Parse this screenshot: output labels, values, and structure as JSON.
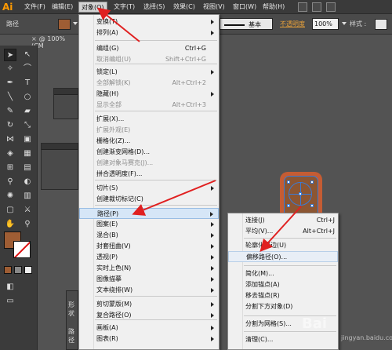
{
  "app": {
    "logo": "Ai",
    "menus": [
      "文件(F)",
      "编辑(E)",
      "对象(O)",
      "文字(T)",
      "选择(S)",
      "效果(C)",
      "视图(V)",
      "窗口(W)",
      "帮助(H)"
    ],
    "active_menu": "对象(O)"
  },
  "control_bar": {
    "selection_label": "路径",
    "stroke_style": "基本",
    "opacity_label": "不透明度",
    "opacity_value": "100%",
    "style_label": "样式 :",
    "fill_color": "#9e5d34"
  },
  "document": {
    "tab_label": "@ 100% (CM"
  },
  "tools": {
    "fill_color": "#9e5d34",
    "stroke_color": "#ffffff"
  },
  "object_menu": {
    "items": [
      {
        "label": "变换(T)",
        "shortcut": "",
        "submenu": true,
        "disabled": false
      },
      {
        "label": "排列(A)",
        "shortcut": "",
        "submenu": true,
        "disabled": false
      },
      {
        "label": "编组(G)",
        "shortcut": "Ctrl+G",
        "submenu": false,
        "disabled": false
      },
      {
        "label": "取消编组(U)",
        "shortcut": "Shift+Ctrl+G",
        "submenu": false,
        "disabled": true
      },
      {
        "label": "锁定(L)",
        "shortcut": "",
        "submenu": true,
        "disabled": false
      },
      {
        "label": "全部解锁(K)",
        "shortcut": "Alt+Ctrl+2",
        "submenu": false,
        "disabled": true
      },
      {
        "label": "隐藏(H)",
        "shortcut": "",
        "submenu": true,
        "disabled": false
      },
      {
        "label": "显示全部",
        "shortcut": "Alt+Ctrl+3",
        "submenu": false,
        "disabled": true
      },
      {
        "label": "扩展(X)...",
        "shortcut": "",
        "submenu": false,
        "disabled": false
      },
      {
        "label": "扩展外观(E)",
        "shortcut": "",
        "submenu": false,
        "disabled": true
      },
      {
        "label": "栅格化(Z)...",
        "shortcut": "",
        "submenu": false,
        "disabled": false
      },
      {
        "label": "创建渐变网格(D)...",
        "shortcut": "",
        "submenu": false,
        "disabled": false
      },
      {
        "label": "创建对象马赛克(J)...",
        "shortcut": "",
        "submenu": false,
        "disabled": true
      },
      {
        "label": "拼合透明度(F)...",
        "shortcut": "",
        "submenu": false,
        "disabled": false
      },
      {
        "label": "切片(S)",
        "shortcut": "",
        "submenu": true,
        "disabled": false
      },
      {
        "label": "创建裁切标记(C)",
        "shortcut": "",
        "submenu": false,
        "disabled": false
      },
      {
        "label": "路径(P)",
        "shortcut": "",
        "submenu": true,
        "disabled": false
      },
      {
        "label": "图案(E)",
        "shortcut": "",
        "submenu": true,
        "disabled": false
      },
      {
        "label": "混合(B)",
        "shortcut": "",
        "submenu": true,
        "disabled": false
      },
      {
        "label": "封套扭曲(V)",
        "shortcut": "",
        "submenu": true,
        "disabled": false
      },
      {
        "label": "透视(P)",
        "shortcut": "",
        "submenu": true,
        "disabled": false
      },
      {
        "label": "实时上色(N)",
        "shortcut": "",
        "submenu": true,
        "disabled": false
      },
      {
        "label": "图像描摹",
        "shortcut": "",
        "submenu": true,
        "disabled": false
      },
      {
        "label": "文本绕排(W)",
        "shortcut": "",
        "submenu": true,
        "disabled": false
      },
      {
        "label": "剪切蒙版(M)",
        "shortcut": "",
        "submenu": true,
        "disabled": false
      },
      {
        "label": "复合路径(O)",
        "shortcut": "",
        "submenu": true,
        "disabled": false
      },
      {
        "label": "画板(A)",
        "shortcut": "",
        "submenu": true,
        "disabled": false
      },
      {
        "label": "图表(R)",
        "shortcut": "",
        "submenu": true,
        "disabled": false
      }
    ]
  },
  "path_submenu": {
    "items": [
      {
        "label": "连接(J)",
        "shortcut": "Ctrl+J",
        "disabled": false
      },
      {
        "label": "平均(V)...",
        "shortcut": "Alt+Ctrl+J",
        "disabled": false
      },
      {
        "label": "轮廓化描边(U)",
        "shortcut": "",
        "disabled": false
      },
      {
        "label": "偏移路径(O)...",
        "shortcut": "",
        "disabled": false
      },
      {
        "label": "简化(M)...",
        "shortcut": "",
        "disabled": false
      },
      {
        "label": "添加锚点(A)",
        "shortcut": "",
        "disabled": false
      },
      {
        "label": "移去锚点(R)",
        "shortcut": "",
        "disabled": false
      },
      {
        "label": "分割下方对象(D)",
        "shortcut": "",
        "disabled": false
      },
      {
        "label": "分割为网格(S)...",
        "shortcut": "",
        "disabled": false
      },
      {
        "label": "清理(C)...",
        "shortcut": "",
        "disabled": false
      }
    ]
  },
  "canvas_art": {
    "outer_color": "#c55c33",
    "inner_color": "#8c5633",
    "selection_color": "#3a7bd5"
  },
  "annotation_color": "#e02020",
  "watermark": {
    "brand": "Bai",
    "sub": "jingyan.baidu.com"
  },
  "panel_fragments": {
    "left_label": "形状",
    "left_label2": "路径"
  }
}
